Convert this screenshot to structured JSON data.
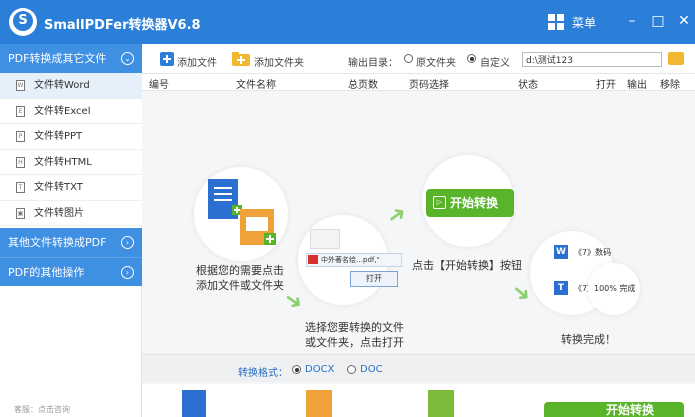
{
  "window": {
    "title": "SmallPDFer转换器V6.8",
    "menu_label": "菜单",
    "minimize": "–",
    "maximize": "□",
    "close": "✕"
  },
  "sidebar": {
    "section1": "PDF转换成其它文件",
    "items": [
      {
        "label": "文件转Word",
        "icon": "W"
      },
      {
        "label": "文件转Excel",
        "icon": "E"
      },
      {
        "label": "文件转PPT",
        "icon": "P"
      },
      {
        "label": "文件转HTML",
        "icon": "H"
      },
      {
        "label": "文件转TXT",
        "icon": "T"
      },
      {
        "label": "文件转图片",
        "icon": "▣"
      }
    ],
    "section2": "其他文件转换成PDF",
    "section3": "PDF的其他操作",
    "footer": "客服：点击咨询"
  },
  "toolbar": {
    "add_file": "添加文件",
    "add_folder": "添加文件夹",
    "output_label": "输出目录：",
    "opt_original": "原文件夹",
    "opt_custom": "自定义",
    "path_value": "d:\\测试123"
  },
  "table": {
    "headers": [
      "编号",
      "文件名称",
      "总页数",
      "页码选择",
      "状态",
      "打开",
      "输出",
      "移除"
    ]
  },
  "guide": {
    "step1": [
      "根据您的需要点击",
      "添加文件或文件夹"
    ],
    "step2": [
      "选择您要转换的文件",
      "或文件夹，点击打开"
    ],
    "step2_file": "中外著名绘…pdf,\"",
    "step2_open": "打开",
    "step3_button": "开始转换",
    "step3": "点击【开始转换】按钮",
    "step4": "转换完成！",
    "step4_w": "《7》数码",
    "step4_t": "《7》",
    "step4_done": "100% 完成"
  },
  "format": {
    "label": "转换格式：",
    "opt1": "DOCX",
    "opt2": "DOC"
  },
  "bottom": {
    "start_button": "开始转换"
  },
  "colors": {
    "titlebar": "#2b7fd8",
    "sidebar_head": "#3f8fe3",
    "green": "#5ab42a",
    "link_blue": "#2a6fc4"
  }
}
